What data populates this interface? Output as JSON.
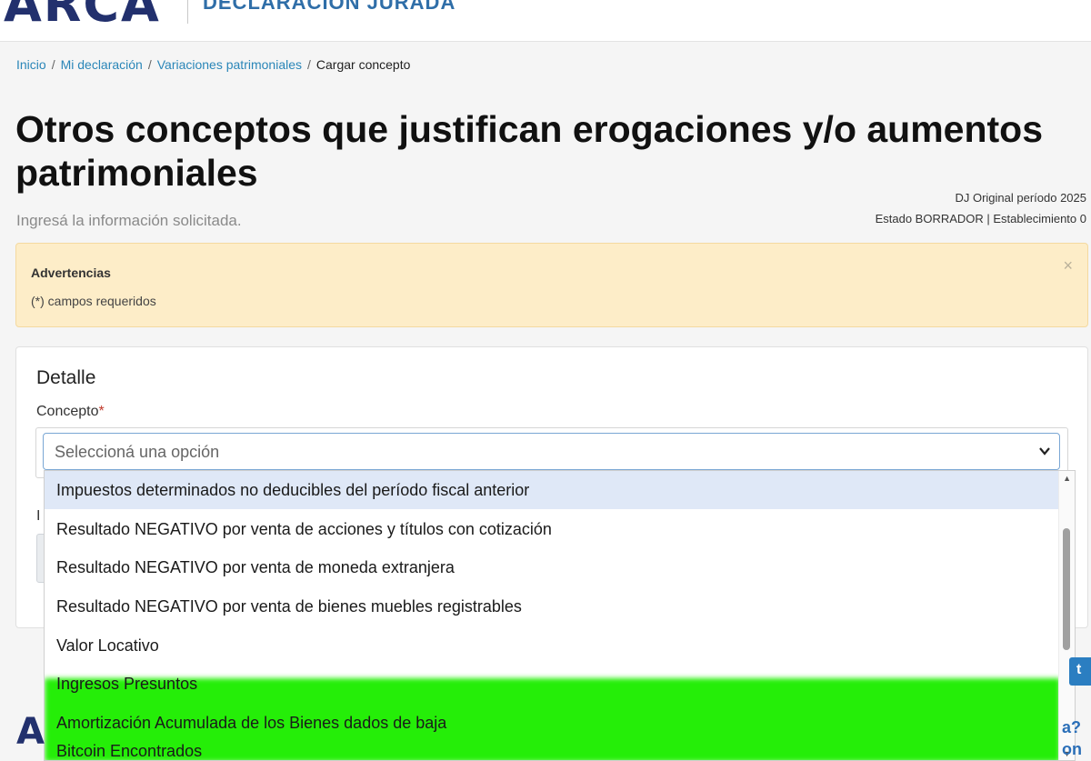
{
  "header": {
    "logo": "ARCA",
    "app_title": "DECLARACIÓN JURADA"
  },
  "breadcrumb": {
    "items": [
      "Inicio",
      "Mi declaración",
      "Variaciones patrimoniales"
    ],
    "current": "Cargar concepto",
    "separator": "/"
  },
  "page": {
    "title": "Otros conceptos que justifican erogaciones y/o aumentos patrimoniales",
    "subtitle": "Ingresá la información solicitada.",
    "meta_line1": "DJ Original período 2025",
    "meta_line2": "Estado BORRADOR | Establecimiento 0"
  },
  "alert": {
    "title": "Advertencias",
    "text": "(*) campos requeridos",
    "close": "×"
  },
  "form": {
    "card_title": "Detalle",
    "concepto_label": "Concepto",
    "required_mark": "*",
    "concepto_placeholder": "Seleccioná una opción",
    "next_label_partial": "I"
  },
  "dropdown": {
    "options": [
      "Impuestos determinados no deducibles del período fiscal anterior",
      "Resultado NEGATIVO por venta de acciones y títulos con cotización",
      "Resultado NEGATIVO por venta de moneda extranjera",
      "Resultado NEGATIVO por venta de bienes muebles registrables",
      "Valor Locativo",
      "Ingresos Presuntos",
      "Amortización Acumulada de los Bienes dados de baja",
      "Bitcoin Encontrados"
    ],
    "highlighted_index": 0
  },
  "partial": {
    "footer_logo": "A",
    "right_button": "t",
    "help_text": "a?\non"
  },
  "colors": {
    "brand": "#22306d",
    "link": "#2a86b8",
    "alert_bg": "#fdedc8",
    "option_highlight": "#dfe8f7",
    "green_highlight": "#25ee08",
    "required": "#c0392b"
  }
}
